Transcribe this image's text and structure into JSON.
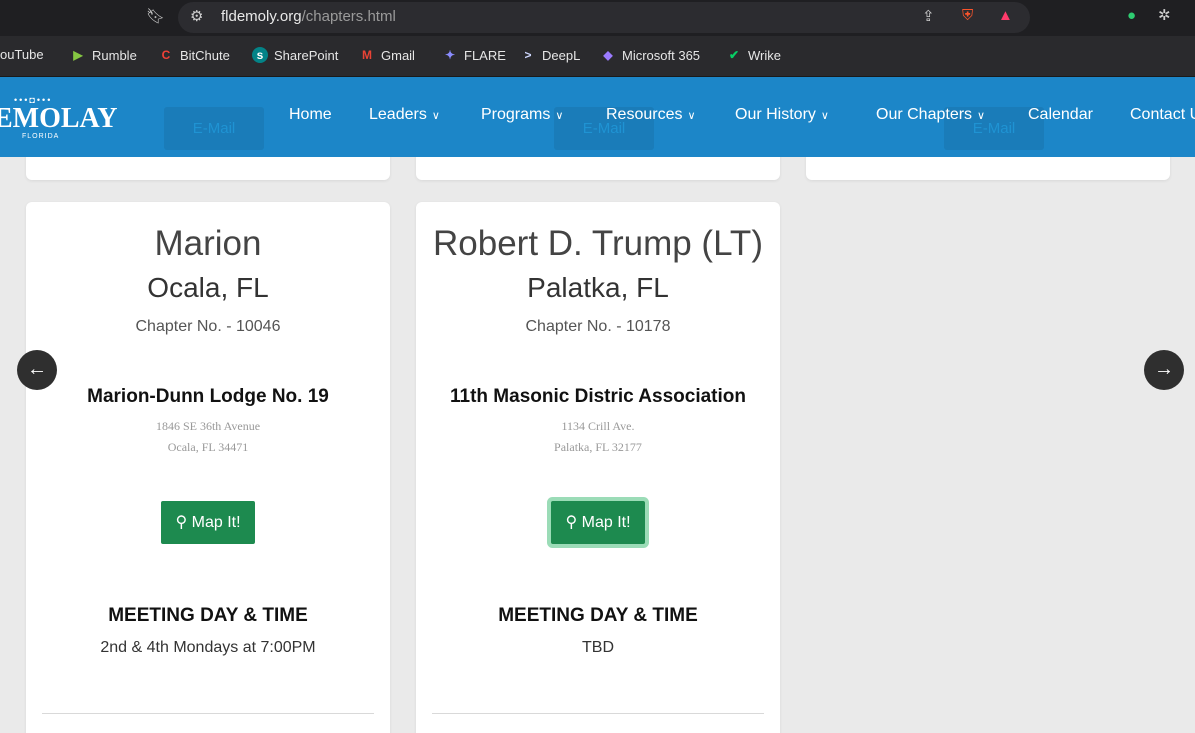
{
  "browser": {
    "url_host": "fldemoly.org",
    "url_path": "/chapters.html",
    "bookmarks": [
      {
        "label": "ouTube",
        "icon": "youtube-icon",
        "color": "#ff0000"
      },
      {
        "label": "Rumble",
        "icon": "rumble-icon",
        "color": "#85c742"
      },
      {
        "label": "BitChute",
        "icon": "bitchute-icon",
        "color": "#ef4137"
      },
      {
        "label": "SharePoint",
        "icon": "sharepoint-icon",
        "color": "#038387"
      },
      {
        "label": "Gmail",
        "icon": "gmail-icon",
        "color": "#ea4335"
      },
      {
        "label": "FLARE",
        "icon": "flare-icon",
        "color": "#6b7bff"
      },
      {
        "label": "DeepL",
        "icon": "deepl-icon",
        "color": "#0f2b46"
      },
      {
        "label": "Microsoft 365",
        "icon": "microsoft365-icon",
        "color": "#7b5cd6"
      },
      {
        "label": "Wrike",
        "icon": "wrike-icon",
        "color": "#08cf65"
      }
    ]
  },
  "site": {
    "logo_text": "EMOLAY",
    "logo_sub": "FLORIDA",
    "nav": [
      {
        "label": "Home",
        "dropdown": false
      },
      {
        "label": "Leaders",
        "dropdown": true
      },
      {
        "label": "Programs",
        "dropdown": true
      },
      {
        "label": "Resources",
        "dropdown": true
      },
      {
        "label": "Our History",
        "dropdown": true
      },
      {
        "label": "Our Chapters",
        "dropdown": true
      },
      {
        "label": "Calendar",
        "dropdown": false
      },
      {
        "label": "Contact U",
        "dropdown": false
      }
    ],
    "ghost_email_label": "E-Mail"
  },
  "cards": [
    {
      "name": "Marion",
      "city": "Ocala, FL",
      "chapter_no": "Chapter No. - 10046",
      "lodge": "Marion-Dunn Lodge No. 19",
      "addr1": "1846 SE 36th Avenue",
      "addr2": "Ocala, FL 34471",
      "map_label": "Map It!",
      "meeting_heading": "MEETING DAY & TIME",
      "meeting_time": "2nd & 4th Mondays at 7:00PM"
    },
    {
      "name": "Robert D. Trump (LT)",
      "city": "Palatka, FL",
      "chapter_no": "Chapter No. - 10178",
      "lodge": "11th Masonic Distric Association",
      "addr1": "1134 Crill Ave.",
      "addr2": "Palatka, FL 32177",
      "map_label": "Map It!",
      "meeting_heading": "MEETING DAY & TIME",
      "meeting_time": "TBD"
    }
  ],
  "colors": {
    "nav_bg": "#1c86c8",
    "map_button": "#1d8a4f"
  }
}
